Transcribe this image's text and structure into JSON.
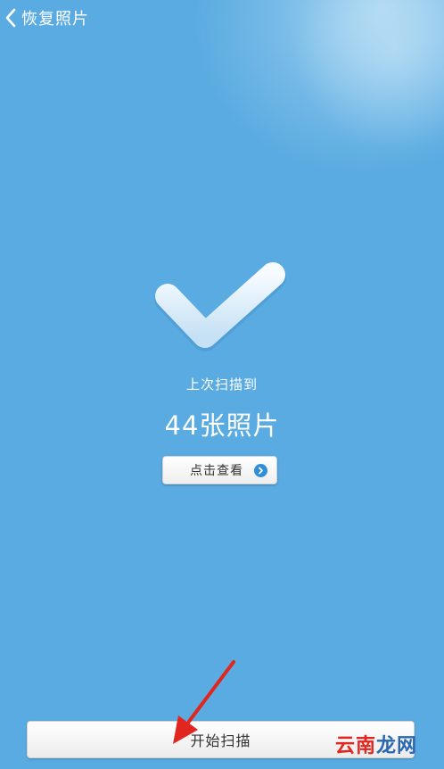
{
  "header": {
    "back_icon": "chevron-left-icon",
    "title": "恢复照片"
  },
  "result": {
    "check_icon": "checkmark-icon",
    "label": "上次扫描到",
    "count_text": "44张照片",
    "count": 44
  },
  "view_button": {
    "label": "点击查看",
    "icon": "chevron-right-circle-icon"
  },
  "start_button": {
    "label": "开始扫描"
  },
  "watermark": {
    "part1": "云南",
    "part2": "龙网"
  },
  "colors": {
    "background": "#5aabe1",
    "accent": "#2f8fd8",
    "arrow": "#e0261f",
    "watermark_red": "#e0261f",
    "watermark_blue": "#2a67b3"
  }
}
